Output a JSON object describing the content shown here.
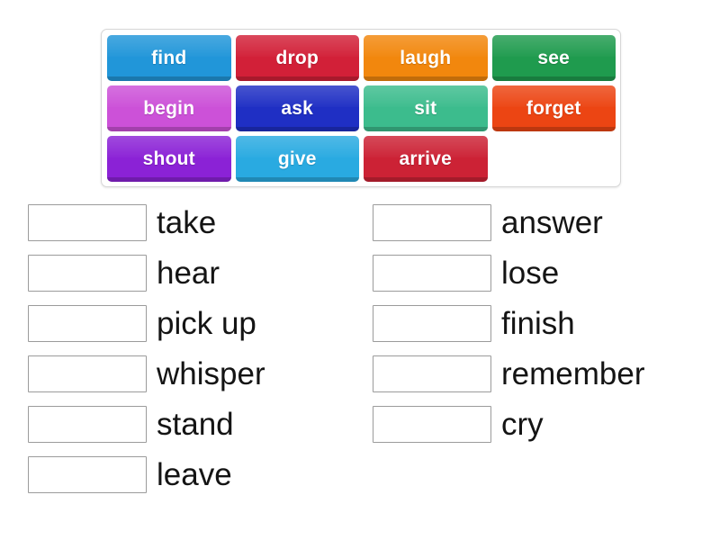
{
  "activity": {
    "type": "match-up-drag-drop",
    "word_bank": {
      "rows": [
        [
          {
            "label": "find",
            "color": "#2196d9"
          },
          {
            "label": "drop",
            "color": "#d22038"
          },
          {
            "label": "laugh",
            "color": "#f2870d"
          },
          {
            "label": "see",
            "color": "#1f9b4e"
          }
        ],
        [
          {
            "label": "begin",
            "color": "#cc51d8"
          },
          {
            "label": "ask",
            "color": "#1f2fc4"
          },
          {
            "label": "sit",
            "color": "#3cbc8d"
          },
          {
            "label": "forget",
            "color": "#ec4513"
          }
        ],
        [
          {
            "label": "shout",
            "color": "#8b22d6"
          },
          {
            "label": "give",
            "color": "#29aae1"
          },
          {
            "label": "arrive",
            "color": "#cc2235"
          }
        ]
      ]
    },
    "answers": {
      "left_column": [
        {
          "slot_value": "",
          "label": "take"
        },
        {
          "slot_value": "",
          "label": "hear"
        },
        {
          "slot_value": "",
          "label": "pick up"
        },
        {
          "slot_value": "",
          "label": "whisper"
        },
        {
          "slot_value": "",
          "label": "stand"
        },
        {
          "slot_value": "",
          "label": "leave"
        }
      ],
      "right_column": [
        {
          "slot_value": "",
          "label": "answer"
        },
        {
          "slot_value": "",
          "label": "lose"
        },
        {
          "slot_value": "",
          "label": "finish"
        },
        {
          "slot_value": "",
          "label": "remember"
        },
        {
          "slot_value": "",
          "label": "cry"
        }
      ]
    }
  }
}
